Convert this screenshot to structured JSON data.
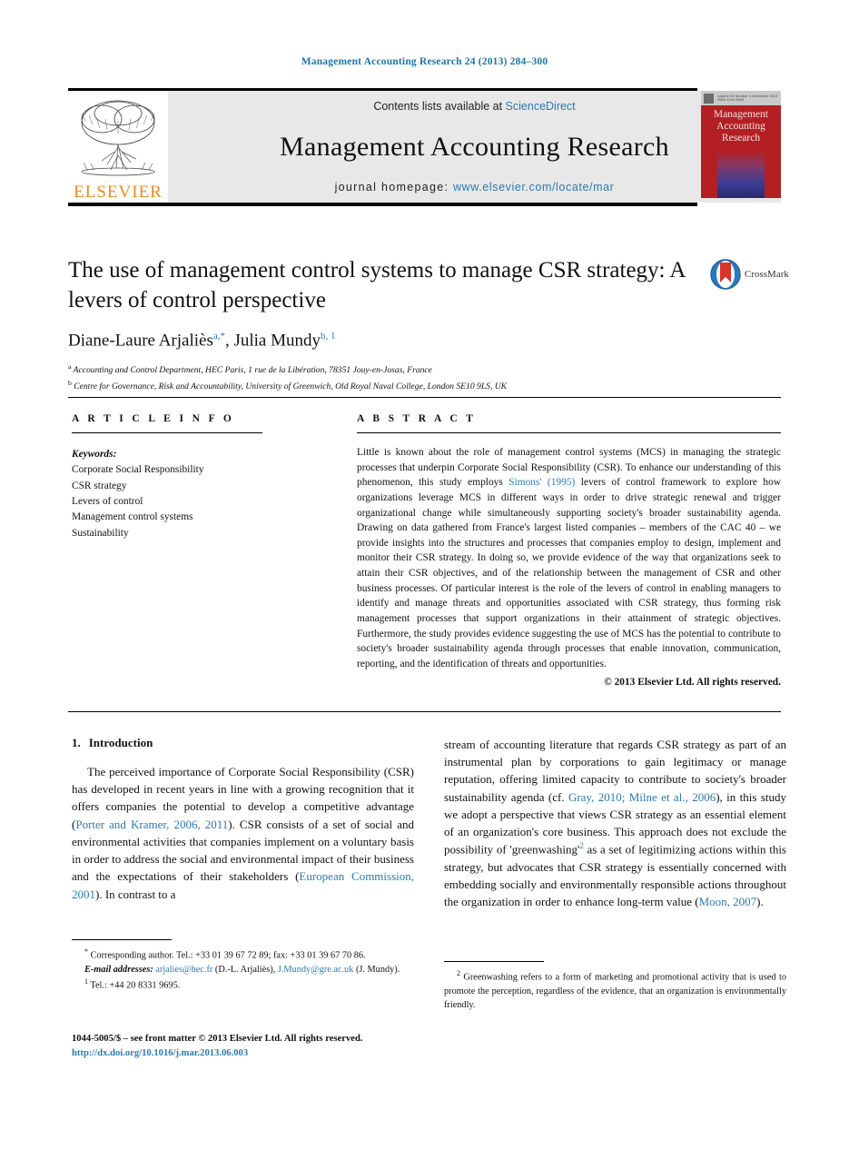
{
  "running_head": "Management Accounting Research 24 (2013) 284–300",
  "banner": {
    "contents_prefix": "Contents lists available at ",
    "sciencedirect": "ScienceDirect",
    "journal_title": "Management Accounting Research",
    "homepage_prefix": "journal homepage:",
    "homepage_url": "www.elsevier.com/locate/mar",
    "publisher_wordmark": "ELSEVIER",
    "cover": {
      "header_text": "volume 24 Number 4    December 2013    ISSN 1044-5005",
      "title_line1": "Management",
      "title_line2": "Accounting",
      "title_line3": "Research"
    },
    "colors": {
      "link": "#2a7ab0",
      "elsevier_orange": "#f08a1d",
      "cover_red": "#b41f24"
    }
  },
  "article": {
    "title": "The use of management control systems to manage CSR strategy: A levers of control perspective",
    "authors": [
      {
        "name": "Diane-Laure Arjaliès",
        "marks": "a,*"
      },
      {
        "name": "Julia Mundy",
        "marks": "b,1"
      }
    ],
    "authors_line_1_name": "Diane-Laure Arjaliès",
    "authors_line_1_sup_a": "a",
    "authors_line_1_sup_star": ",*",
    "authors_sep": ", ",
    "authors_line_2_name": "Julia Mundy",
    "authors_line_2_sup": "b, 1",
    "affiliations": [
      {
        "mark": "a",
        "text": "Accounting and Control Department, HEC Paris, 1 rue de la Libération, 78351 Jouy-en-Josas, France"
      },
      {
        "mark": "b",
        "text": "Centre for Governance, Risk and Accountability, University of Greenwich, Old Royal Naval College, London SE10 9LS, UK"
      }
    ],
    "crossmark_label": "CrossMark"
  },
  "info": {
    "heading": "A R T I C L E   I N F O",
    "keywords_heading": "Keywords:",
    "keywords": [
      "Corporate Social Responsibility",
      "CSR strategy",
      "Levers of control",
      "Management control systems",
      "Sustainability"
    ]
  },
  "abstract": {
    "heading": "A B S T R A C T",
    "part1": "Little is known about the role of management control systems (MCS) in managing the strategic processes that underpin Corporate Social Responsibility (CSR). To enhance our understanding of this phenomenon, this study employs ",
    "link1": "Simons' (1995)",
    "part2": " levers of control framework to explore how organizations leverage MCS in different ways in order to drive strategic renewal and trigger organizational change while simultaneously supporting society's broader sustainability agenda. Drawing on data gathered from France's largest listed companies – members of the CAC 40 – we provide insights into the structures and processes that companies employ to design, implement and monitor their CSR strategy. In doing so, we provide evidence of the way that organizations seek to attain their CSR objectives, and of the relationship between the management of CSR and other business processes. Of particular interest is the role of the levers of control in enabling managers to identify and manage threats and opportunities associated with CSR strategy, thus forming risk management processes that support organizations in their attainment of strategic objectives. Furthermore, the study provides evidence suggesting the use of MCS has the potential to contribute to society's broader sustainability agenda through processes that enable innovation, communication, reporting, and the identification of threats and opportunities.",
    "copyright": "© 2013 Elsevier Ltd. All rights reserved."
  },
  "body": {
    "section_number": "1.",
    "section_title": "Introduction",
    "left_para_1": "The perceived importance of Corporate Social Responsibility (CSR) has developed in recent years in line with a growing recognition that it offers companies the potential to develop a competitive advantage (",
    "left_link_1": "Porter and Kramer, 2006, 2011",
    "left_para_2": "). CSR consists of a set of social and environmental activities that companies implement on a voluntary basis in order to address the social and environmental impact of their business and the expectations of their stakeholders (",
    "left_link_2": "European Commission, 2001",
    "left_para_3": "). In contrast to a",
    "right_para_1": "stream of accounting literature that regards CSR strategy as part of an instrumental plan by corporations to gain legitimacy or manage reputation, offering limited capacity to contribute to society's broader sustainability agenda (cf. ",
    "right_link_1": "Gray, 2010; Milne et al., 2006",
    "right_para_2": "), in this study we adopt a perspective that views CSR strategy as an essential element of an organization's core business. This approach does not exclude the possibility of 'greenwashing'",
    "right_footnote_mark": "2",
    "right_para_3": " as a set of legitimizing actions within this strategy, but advocates that CSR strategy is essentially concerned with embedding socially and environmentally responsible actions throughout the organization in order to enhance long-term value (",
    "right_link_2": "Moon, 2007",
    "right_para_4": ")."
  },
  "footnotes": {
    "corresponding_mark": "*",
    "corresponding_text": "Corresponding author. Tel.: +33 01 39 67 72 89; fax: +33 01 39 67 70 86.",
    "email_label": "E-mail addresses:",
    "email_1": "arjalies@hec.fr",
    "email_1_owner": "(D.-L. Arjaliès),",
    "email_2": "J.Mundy@gre.ac.uk",
    "email_2_owner": "(J. Mundy).",
    "tel_mark": "1",
    "tel_text": "Tel.: +44 20 8331 9695.",
    "greenwashing_mark": "2",
    "greenwashing_text": "Greenwashing refers to a form of marketing and promotional activity that is used to promote the perception, regardless of the evidence, that an organization is environmentally friendly."
  },
  "imprint": {
    "line1": "1044-5005/$ – see front matter © 2013 Elsevier Ltd. All rights reserved.",
    "doi": "http://dx.doi.org/10.1016/j.mar.2013.06.003"
  }
}
